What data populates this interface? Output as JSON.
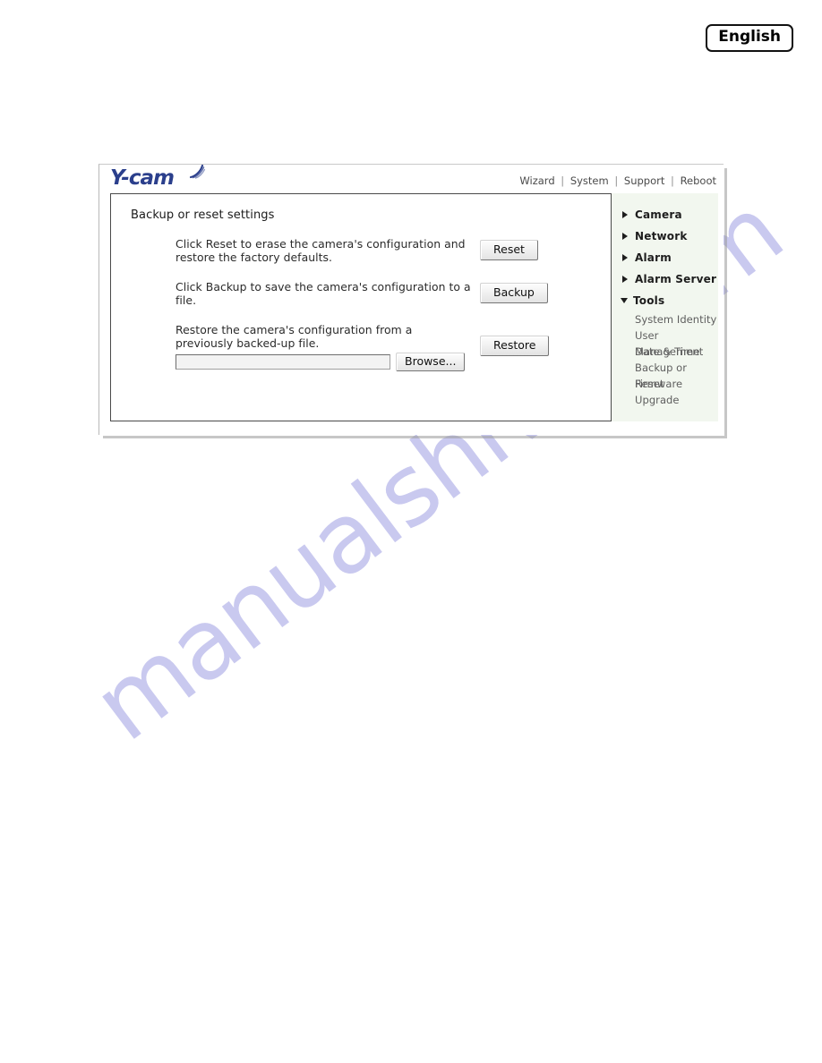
{
  "language_badge": {
    "label": "English"
  },
  "watermark": {
    "text": "manualshive.com",
    "color": "#c9c9ef"
  },
  "header": {
    "logo_text": "Y-cam",
    "logo_icon": "wifi-arc-icon",
    "top_links": [
      {
        "label": "Wizard"
      },
      {
        "label": "System"
      },
      {
        "label": "Support"
      },
      {
        "label": "Reboot"
      }
    ],
    "separator": "|"
  },
  "content": {
    "title": "Backup or reset settings",
    "rows": [
      {
        "text": "Click Reset to erase the camera's configuration and restore the factory defaults.",
        "button": "Reset"
      },
      {
        "text": "Click Backup to save the camera's configuration to a file.",
        "button": "Backup"
      },
      {
        "text": "Restore the camera's configuration from a previously backed-up file.",
        "button": "Restore"
      }
    ],
    "file_picker": {
      "value": "",
      "placeholder": "",
      "browse_label": "Browse..."
    }
  },
  "sidebar": {
    "background_color": "#f2f7ef",
    "items": [
      {
        "label": "Camera",
        "expanded": false
      },
      {
        "label": "Network",
        "expanded": false
      },
      {
        "label": "Alarm",
        "expanded": false
      },
      {
        "label": "Alarm Server",
        "expanded": false
      },
      {
        "label": "Tools",
        "expanded": true
      }
    ],
    "sub_items": [
      {
        "label": "System Identity"
      },
      {
        "label": "User Management"
      },
      {
        "label": "Date & Time"
      },
      {
        "label": "Backup or Reset"
      },
      {
        "label": "Firmware Upgrade"
      }
    ]
  }
}
